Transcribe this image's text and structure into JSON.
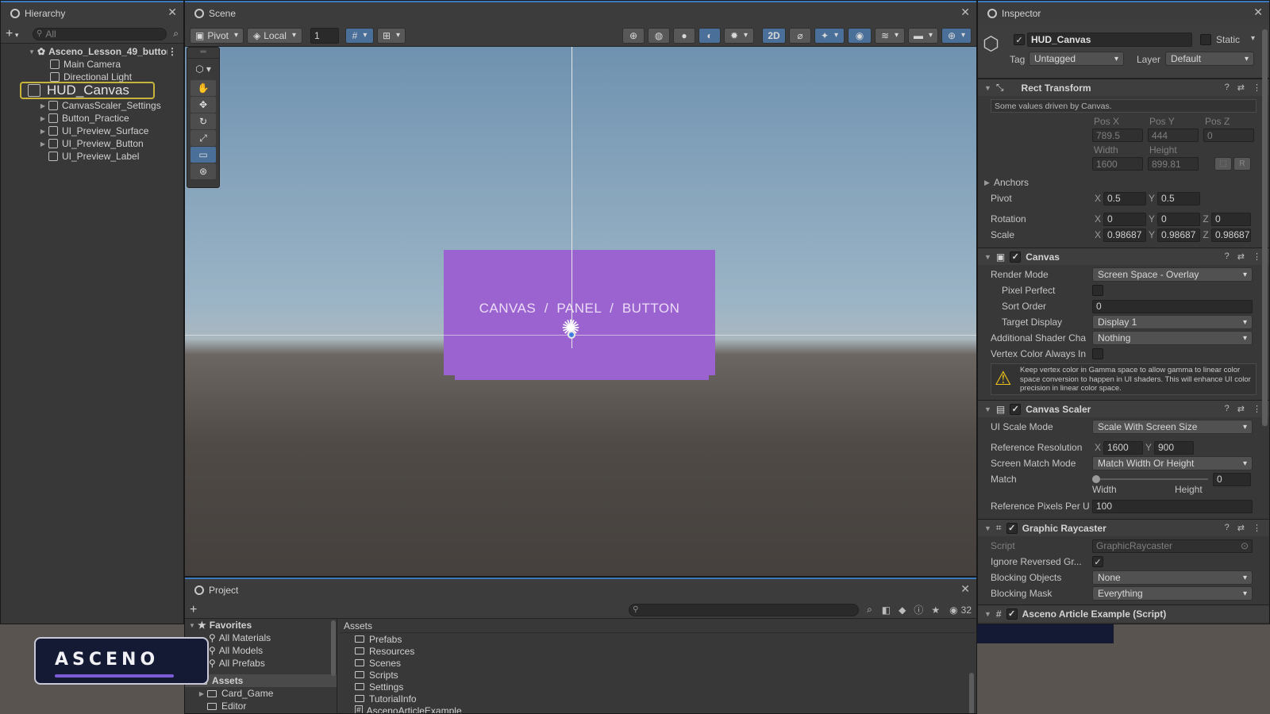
{
  "hierarchy": {
    "tab_title": "Hierarchy",
    "add_label": "+",
    "search_placeholder": "All",
    "scene_name": "Asceno_Lesson_49_buttor",
    "items": [
      {
        "label": "Main Camera"
      },
      {
        "label": "Directional Light"
      },
      {
        "label": "HUD_Canvas"
      },
      {
        "label": "CanvasScaler_Settings"
      },
      {
        "label": "Button_Practice"
      },
      {
        "label": "UI_Preview_Surface"
      },
      {
        "label": "UI_Preview_Button"
      },
      {
        "label": "UI_Preview_Label"
      }
    ]
  },
  "scene": {
    "tab_title": "Scene",
    "pivot_label": "Pivot",
    "local_label": "Local",
    "grid_value": "1",
    "mode_2d": "2D",
    "canvas_text": "CANVAS  /  PANEL  /  BUTTON",
    "colors": {
      "panel": "#9b63cf",
      "sky": "#7fa0b8",
      "ground": "#4b4744"
    }
  },
  "project": {
    "tab_title": "Project",
    "add_label": "+",
    "hidden_count": "32",
    "favorites_label": "Favorites",
    "favorites": [
      "All Materials",
      "All Models",
      "All Prefabs"
    ],
    "assets_label": "Assets",
    "asset_tree": [
      "Card_Game",
      "Editor"
    ],
    "breadcrumb": "Assets",
    "folders": [
      "Prefabs",
      "Resources",
      "Scenes",
      "Scripts",
      "Settings",
      "TutorialInfo",
      "AscenoArticleExample"
    ]
  },
  "logo": {
    "text": "ASCENO",
    "accent": "#7b5cd6"
  },
  "inspector": {
    "tab_title": "Inspector",
    "object_name": "HUD_Canvas",
    "static_label": "Static",
    "tag_label": "Tag",
    "tag_value": "Untagged",
    "layer_label": "Layer",
    "layer_value": "Default",
    "rect_transform": {
      "title": "Rect Transform",
      "note": "Some values driven by Canvas.",
      "pos_x_label": "Pos X",
      "pos_y_label": "Pos Y",
      "pos_z_label": "Pos Z",
      "pos_x": "789.5",
      "pos_y": "444",
      "pos_z": "0",
      "width_label": "Width",
      "height_label": "Height",
      "width": "1600",
      "height": "899.81",
      "r_label": "R",
      "anchors_label": "Anchors",
      "pivot_label": "Pivot",
      "pivot_x": "0.5",
      "pivot_y": "0.5",
      "rotation_label": "Rotation",
      "rot_x": "0",
      "rot_y": "0",
      "rot_z": "0",
      "scale_label": "Scale",
      "scale_x": "0.98687",
      "scale_y": "0.98687",
      "scale_z": "0.98687",
      "x": "X",
      "y": "Y",
      "z": "Z"
    },
    "canvas": {
      "title": "Canvas",
      "render_mode_label": "Render Mode",
      "render_mode": "Screen Space - Overlay",
      "pixel_perfect_label": "Pixel Perfect",
      "sort_order_label": "Sort Order",
      "sort_order": "0",
      "target_display_label": "Target Display",
      "target_display": "Display 1",
      "shader_channels_label": "Additional Shader Cha",
      "shader_channels": "Nothing",
      "vertex_color_label": "Vertex Color Always In",
      "warning": "Keep vertex color in Gamma space to allow gamma to linear color space conversion to happen in UI shaders. This will enhance UI color precision in linear color space."
    },
    "canvas_scaler": {
      "title": "Canvas Scaler",
      "ui_scale_mode_label": "UI Scale Mode",
      "ui_scale_mode": "Scale With Screen Size",
      "ref_res_label": "Reference Resolution",
      "ref_x": "1600",
      "ref_y": "900",
      "match_mode_label": "Screen Match Mode",
      "match_mode": "Match Width Or Height",
      "match_label": "Match",
      "match_value": "0",
      "match_fraction": 0,
      "width_label": "Width",
      "height_label": "Height",
      "ref_ppu_label": "Reference Pixels Per U",
      "ref_ppu": "100"
    },
    "graphic_raycaster": {
      "title": "Graphic Raycaster",
      "script_label": "Script",
      "script_value": "GraphicRaycaster",
      "ignore_reversed_label": "Ignore Reversed Gr...",
      "blocking_objects_label": "Blocking Objects",
      "blocking_objects": "None",
      "blocking_mask_label": "Blocking Mask",
      "blocking_mask": "Everything"
    },
    "next_component": "Asceno Article Example (Script)"
  }
}
